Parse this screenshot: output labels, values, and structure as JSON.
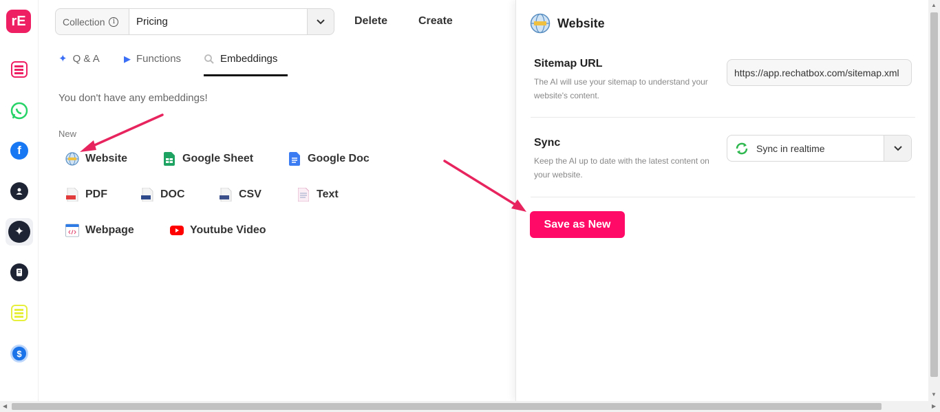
{
  "sidebar": {
    "logo": "rE",
    "items": [
      {
        "name": "sidebar-item-rechatbox",
        "icon": "rechatbox-logo-icon",
        "color": "#ee1f63"
      },
      {
        "name": "sidebar-item-whatsapp",
        "icon": "whatsapp-icon",
        "color": "#25d366"
      },
      {
        "name": "sidebar-item-facebook",
        "icon": "facebook-icon",
        "color": "#1877f2"
      },
      {
        "name": "sidebar-item-contacts",
        "icon": "contact-icon",
        "color": "#1e2433"
      },
      {
        "name": "sidebar-item-ai",
        "icon": "sparkle-icon",
        "color": "#1e2433"
      },
      {
        "name": "sidebar-item-docs",
        "icon": "document-icon",
        "color": "#1e2433"
      },
      {
        "name": "sidebar-item-brand",
        "icon": "brand-logo-icon",
        "color": "#e6f03c"
      },
      {
        "name": "sidebar-item-billing",
        "icon": "dollar-icon",
        "color": "#1a73e8"
      }
    ]
  },
  "topbar": {
    "collection_label": "Collection",
    "collection_value": "Pricing",
    "delete_label": "Delete",
    "create_label": "Create"
  },
  "tabs": [
    {
      "label": "Q & A",
      "icon": "sparkle-icon"
    },
    {
      "label": "Functions",
      "icon": "play-icon"
    },
    {
      "label": "Embeddings",
      "icon": "search-icon"
    }
  ],
  "embeddings": {
    "empty_message": "You don't have any embeddings!",
    "new_label": "New",
    "sources": [
      {
        "label": "Website",
        "icon": "globe-icon"
      },
      {
        "label": "Google Sheet",
        "icon": "google-sheet-icon"
      },
      {
        "label": "Google Doc",
        "icon": "google-doc-icon"
      },
      {
        "label": "PDF",
        "icon": "pdf-file-icon"
      },
      {
        "label": "DOC",
        "icon": "doc-file-icon"
      },
      {
        "label": "CSV",
        "icon": "csv-file-icon"
      },
      {
        "label": "Text",
        "icon": "text-file-icon"
      },
      {
        "label": "Webpage",
        "icon": "webpage-icon"
      },
      {
        "label": "Youtube Video",
        "icon": "youtube-icon"
      }
    ]
  },
  "panel": {
    "title": "Website",
    "sitemap_title": "Sitemap URL",
    "sitemap_help": "The AI will use your sitemap to understand your website's content.",
    "sitemap_value": "https://app.rechatbox.com/sitemap.xml",
    "sync_title": "Sync",
    "sync_help": "Keep the AI up to date with the latest content on your website.",
    "sync_value": "Sync in realtime",
    "save_label": "Save as New"
  },
  "colors": {
    "accent": "#ff0a66",
    "arrow": "#e8245f"
  }
}
